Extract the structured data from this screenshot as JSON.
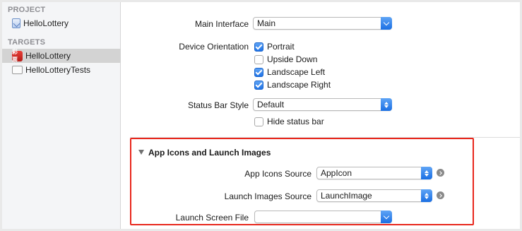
{
  "sidebar": {
    "project_header": "PROJECT",
    "project_item": "HelloLottery",
    "targets_header": "TARGETS",
    "targets": [
      {
        "label": "HelloLottery",
        "icon": "app-icon",
        "icon_text": "彩票",
        "selected": true
      },
      {
        "label": "HelloLotteryTests",
        "icon": "test-bundle-icon",
        "selected": false
      }
    ]
  },
  "deployment": {
    "main_interface": {
      "label": "Main Interface",
      "value": "Main"
    },
    "device_orientation": {
      "label": "Device Orientation",
      "options": [
        {
          "label": "Portrait",
          "checked": true
        },
        {
          "label": "Upside Down",
          "checked": false
        },
        {
          "label": "Landscape Left",
          "checked": true
        },
        {
          "label": "Landscape Right",
          "checked": true
        }
      ]
    },
    "status_bar_style": {
      "label": "Status Bar Style",
      "value": "Default"
    },
    "hide_status_bar": {
      "label": "Hide status bar",
      "checked": false
    }
  },
  "app_icons_section": {
    "title": "App Icons and Launch Images",
    "app_icons_source": {
      "label": "App Icons Source",
      "value": "AppIcon"
    },
    "launch_images_source": {
      "label": "Launch Images Source",
      "value": "LaunchImage"
    },
    "launch_screen_file": {
      "label": "Launch Screen File",
      "value": ""
    }
  },
  "colors": {
    "accent": "#1f73e6",
    "highlight": "#e8271c"
  }
}
